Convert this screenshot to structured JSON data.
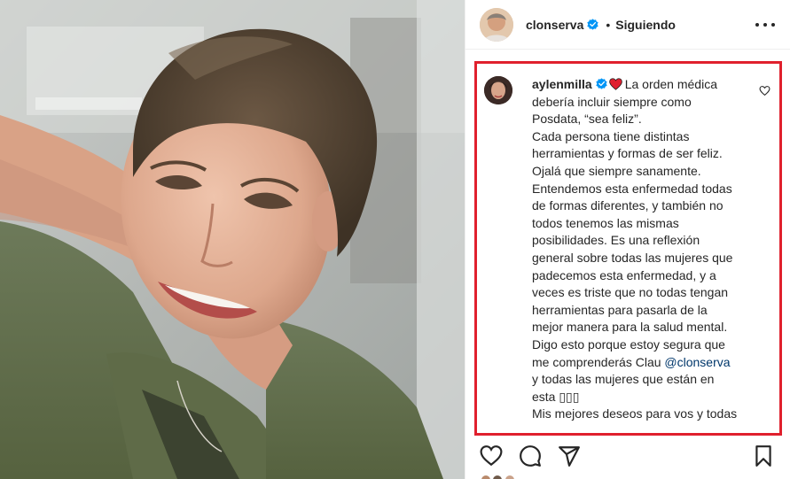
{
  "post": {
    "username": "clonserva",
    "separator": "•",
    "follow_state": "Siguiendo",
    "more_label": "Más opciones"
  },
  "comment": {
    "username": "aylenmilla",
    "text_lines": [
      "La orden médica",
      "debería incluir siempre como",
      "Posdata, “sea feliz”.",
      "Cada persona tiene distintas",
      "herramientas y formas de ser feliz.",
      "Ojalá que siempre sanamente.",
      "Entendemos esta enfermedad todas",
      "de formas diferentes, y también no",
      "todos tenemos las mismas",
      "posibilidades. Es una reflexión",
      "general sobre todas las mujeres que",
      "padecemos esta enfermedad, y a",
      "veces es triste que no todas tengan",
      "herramientas para pasarla de la",
      "mejor manera para la salud mental.",
      "Digo esto porque estoy segura que",
      "me comprenderás Clau ",
      "y todas las mujeres que están en",
      "esta ▯▯▯",
      "Mis mejores deseos para vos y todas"
    ],
    "mention": "@clonserva"
  },
  "colors": {
    "highlight_border": "#e0202d",
    "verified_blue": "#0095f6",
    "mention": "#00376b",
    "heart_red": "#e02030"
  },
  "icons": {
    "like": "heart-outline-icon",
    "comment": "speech-bubble-icon",
    "share": "paper-plane-icon",
    "save": "bookmark-icon",
    "verified": "verified-badge-icon",
    "comment_like": "small-heart-icon"
  }
}
